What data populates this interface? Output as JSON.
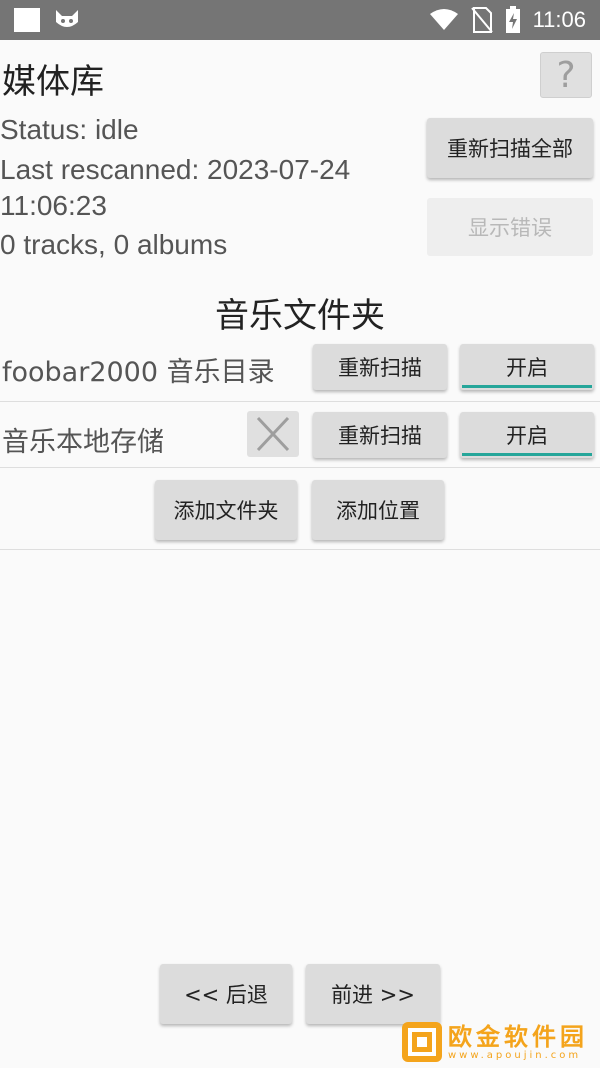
{
  "status_bar": {
    "time": "11:06",
    "left_icons": [
      "square-notification-icon",
      "cat-face-icon"
    ],
    "right_icons": [
      "wifi-icon",
      "no-sim-icon",
      "battery-charging-icon"
    ]
  },
  "header": {
    "title": "媒体库",
    "help_label": "?"
  },
  "info": {
    "status": "Status: idle",
    "last_rescanned_line1": "Last rescanned: 2023-07-24",
    "last_rescanned_line2": "11:06:23",
    "counts": "0 tracks, 0 albums"
  },
  "actions": {
    "rescan_all": "重新扫描全部",
    "show_errors": "显示错误"
  },
  "folders": {
    "section_title": "音乐文件夹",
    "items": [
      {
        "name": "foobar2000 音乐目录",
        "rescan": "重新扫描",
        "toggle": "开启"
      },
      {
        "name": "音乐本地存储",
        "rescan": "重新扫描",
        "toggle": "开启"
      }
    ],
    "add_folder": "添加文件夹",
    "add_location": "添加位置"
  },
  "navigation": {
    "back": "<< 后退",
    "next": "前进 >>"
  },
  "watermark": {
    "name": "欧金软件园",
    "url": "www.apoujin.com"
  },
  "colors": {
    "status_bar": "#757575",
    "toggle_accent": "#26a69a",
    "watermark": "#f4a41c"
  }
}
